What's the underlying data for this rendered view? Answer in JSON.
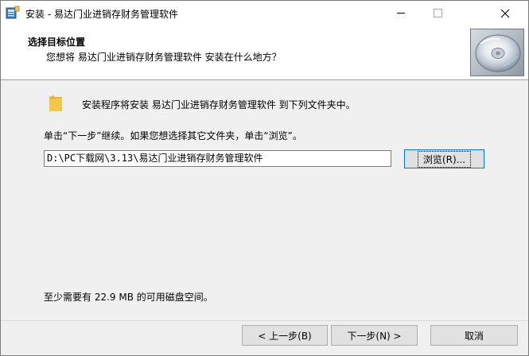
{
  "window": {
    "title": "安装 - 易达门业进销存财务管理软件"
  },
  "header": {
    "title": "选择目标位置",
    "subtitle": "您想将 易达门业进销存财务管理软件 安装在什么地方？"
  },
  "content": {
    "intro": "安装程序将安装 易达门业进销存财务管理软件 到下列文件夹中。",
    "instruction": "单击“下一步”继续。如果您想选择其它文件夹，单击“浏览”。",
    "path_value": "D:\\PC下载网\\3.13\\易达门业进销存财务管理软件",
    "browse_label": "浏览(R)...",
    "space_required": "至少需要有 22.9 MB 的可用磁盘空间。"
  },
  "footer": {
    "back_label": "< 上一步(B)",
    "next_label": "下一步(N) >",
    "cancel_label": "取消"
  },
  "icons": {
    "app": "installer-icon",
    "header_image": "cd-disc-icon",
    "folder": "folder-icon"
  },
  "colors": {
    "focus_border": "#0078d7",
    "button_bg": "#e1e1e1",
    "window_bg": "#f0f0f0",
    "folder": "#f6c64a"
  }
}
